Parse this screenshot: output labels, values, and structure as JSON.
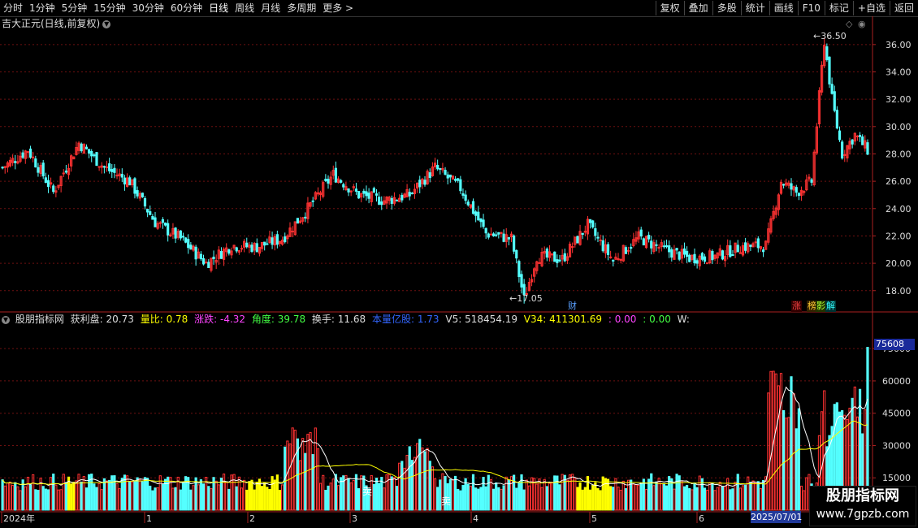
{
  "toolbar": {
    "periods": [
      "分时",
      "1分钟",
      "5分钟",
      "15分钟",
      "30分钟",
      "60分钟",
      "日线",
      "周线",
      "月线",
      "多周期",
      "更多 >"
    ],
    "tools": [
      "复权",
      "叠加",
      "多股",
      "统计",
      "画线",
      "F10",
      "标记",
      "+自选",
      "返回"
    ],
    "active_period": "日线"
  },
  "main_panel": {
    "title": "吉大正元(日线,前复权)",
    "peak_label": "36.50",
    "low_label": "17.05",
    "y_ticks": [
      "36.00",
      "34.00",
      "32.00",
      "30.00",
      "28.00",
      "26.00",
      "24.00",
      "22.00",
      "20.00",
      "18.00"
    ],
    "badges": {
      "cai": "财",
      "zhang": "涨",
      "bang": "榜",
      "ying": "影",
      "jie": "解"
    }
  },
  "indicator_panel": {
    "name": "股朋指标网",
    "fields": [
      {
        "label": "获利盘: 20.73",
        "color": "#dddddd"
      },
      {
        "label": "量比: 0.78",
        "color": "#ffff00"
      },
      {
        "label": "涨跌: -4.32",
        "color": "#ff44ff"
      },
      {
        "label": "角度: 39.78",
        "color": "#44ff44"
      },
      {
        "label": "换手: 11.68",
        "color": "#dddddd"
      },
      {
        "label": "本量亿股: 1.73",
        "color": "#3366ff"
      },
      {
        "label": "V5: 518454.19",
        "color": "#dddddd"
      },
      {
        "label": "V34: 411301.69",
        "color": "#ffff00"
      },
      {
        "label": ": 0.00",
        "color": "#ff44ff"
      },
      {
        "label": ": 0.00",
        "color": "#44ff44"
      },
      {
        "label": "W:",
        "color": "#dddddd"
      }
    ],
    "y_ticks": [
      "75000",
      "60000",
      "45000",
      "30000",
      "15000"
    ],
    "current_vol": "75608",
    "sell_marks": [
      "卖",
      "卖"
    ]
  },
  "x_axis": {
    "labels": [
      "2024年",
      "1",
      "2",
      "3",
      "4",
      "5",
      "6"
    ],
    "current_date": "2025/07/01"
  },
  "watermark": {
    "title": "股朋指标网",
    "url": "www.7gpzb.com"
  },
  "colors": {
    "up": "#ff3232",
    "down": "#54ffff",
    "grid": "#6e1010",
    "axis": "#aa2020",
    "ma_white": "#ffffff",
    "ma_yellow": "#ffff00",
    "highlight_bar": "#ffff00"
  },
  "chart_data": {
    "type": "candlestick",
    "title": "吉大正元(日线,前复权)",
    "ylim": [
      16.5,
      37
    ],
    "close_trend": [
      [
        0,
        27.0
      ],
      [
        10,
        28.3
      ],
      [
        20,
        25.2
      ],
      [
        30,
        28.8
      ],
      [
        40,
        27.0
      ],
      [
        50,
        26.0
      ],
      [
        60,
        23.0
      ],
      [
        70,
        21.8
      ],
      [
        80,
        20.0
      ],
      [
        90,
        21.3
      ],
      [
        100,
        21.2
      ],
      [
        110,
        21.8
      ],
      [
        120,
        24.0
      ],
      [
        130,
        26.5
      ],
      [
        140,
        25.0
      ],
      [
        150,
        24.6
      ],
      [
        160,
        25.0
      ],
      [
        170,
        27.0
      ],
      [
        180,
        25.5
      ],
      [
        190,
        22.2
      ],
      [
        200,
        21.8
      ],
      [
        205,
        17.4
      ],
      [
        210,
        20.5
      ],
      [
        220,
        20.3
      ],
      [
        230,
        22.8
      ],
      [
        240,
        20.2
      ],
      [
        250,
        21.9
      ],
      [
        260,
        21.0
      ],
      [
        270,
        20.4
      ],
      [
        280,
        20.5
      ],
      [
        290,
        21.2
      ],
      [
        300,
        21.3
      ],
      [
        306,
        26.0
      ],
      [
        312,
        25.2
      ],
      [
        318,
        26.0
      ],
      [
        323,
        36.3
      ],
      [
        326,
        32.0
      ],
      [
        330,
        28.0
      ],
      [
        335,
        29.4
      ],
      [
        340,
        28.3
      ]
    ],
    "price_peak": 36.5,
    "price_low": 17.05,
    "volume_ylim": [
      0,
      86000
    ],
    "volume_last": 75608
  }
}
